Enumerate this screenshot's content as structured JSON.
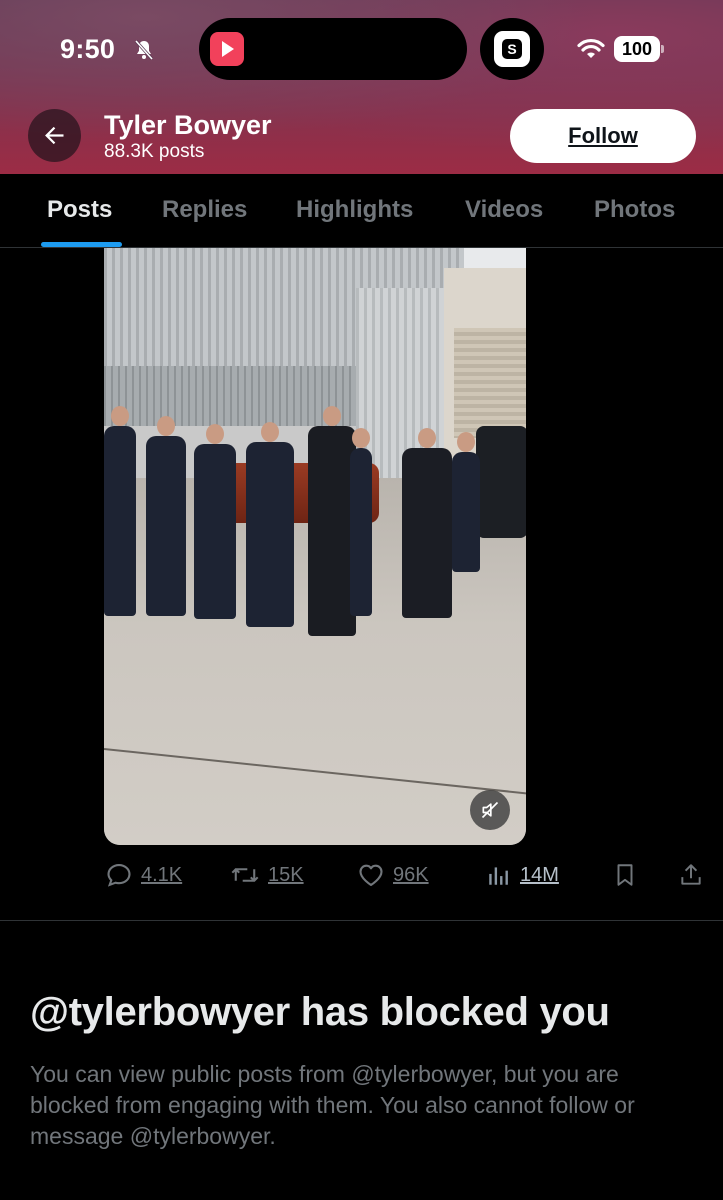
{
  "status_bar": {
    "time": "9:50",
    "battery": "100"
  },
  "header": {
    "name": "Tyler Bowyer",
    "posts_count": "88.3K posts",
    "follow_label": "Follow"
  },
  "tabs": [
    {
      "label": "Posts",
      "active": true
    },
    {
      "label": "Replies",
      "active": false
    },
    {
      "label": "Highlights",
      "active": false
    },
    {
      "label": "Videos",
      "active": false
    },
    {
      "label": "Photos",
      "active": false
    }
  ],
  "post": {
    "media_type": "video",
    "muted": true,
    "actions": {
      "replies": "4.1K",
      "reposts": "15K",
      "likes": "96K",
      "views": "14M"
    }
  },
  "blocked": {
    "title": "@tylerbowyer has blocked you",
    "description": "You can view public posts from @tylerbowyer, but you are blocked from engaging with them. You also cannot follow or message @tylerbowyer."
  },
  "colors": {
    "accent": "#1d9bf0",
    "muted_text": "#71767b",
    "background": "#000000"
  }
}
